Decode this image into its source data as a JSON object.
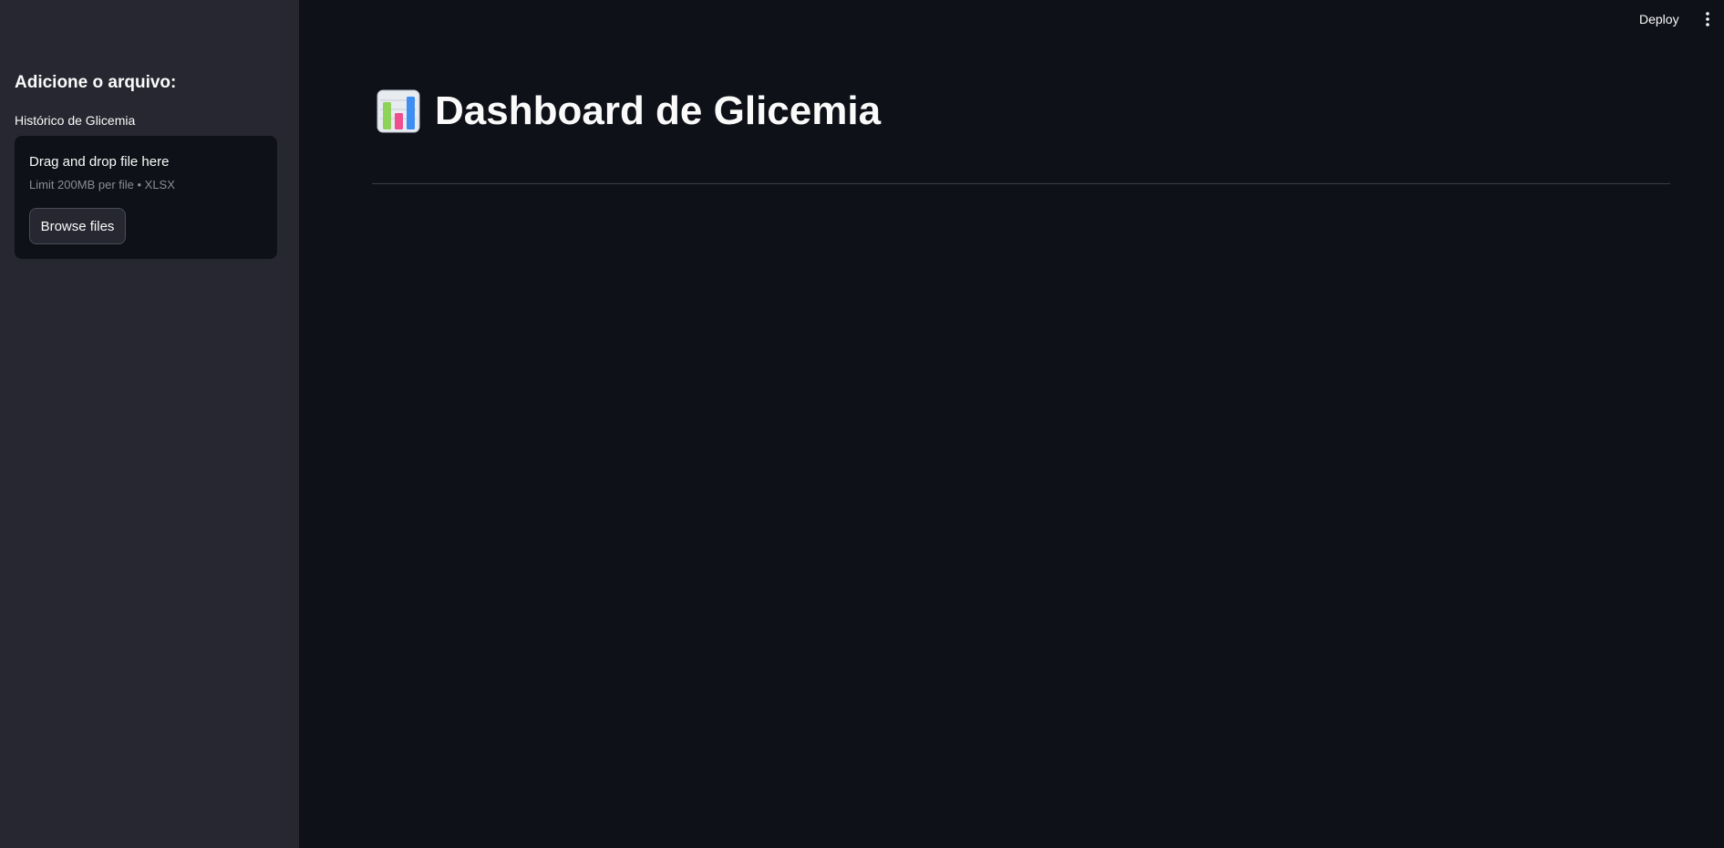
{
  "topbar": {
    "deploy_label": "Deploy",
    "menu_icon": "more-vertical-icon"
  },
  "sidebar": {
    "heading": "Adicione o arquivo:",
    "uploader": {
      "label": "Histórico de Glicemia",
      "drop_text": "Drag and drop file here",
      "limit_text": "Limit 200MB per file • XLSX",
      "browse_label": "Browse files"
    }
  },
  "main": {
    "title_icon": "bar-chart-emoji-icon",
    "title": "Dashboard de Glicemia"
  },
  "colors": {
    "background": "#0e1117",
    "sidebar": "#262730",
    "text": "#fafafa",
    "muted_text": "#8b8d96",
    "divider": "#3a3d47"
  }
}
